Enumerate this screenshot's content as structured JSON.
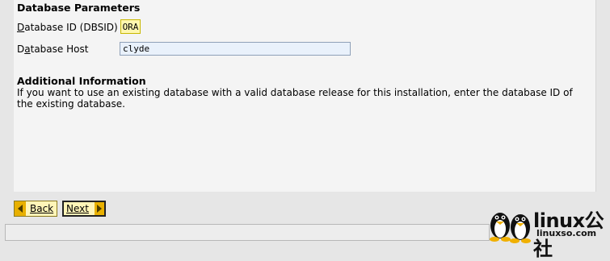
{
  "sections": {
    "db_params_heading": "Database Parameters",
    "additional_info_heading": "Additional Information"
  },
  "fields": {
    "dbsid": {
      "label_u": "D",
      "label_rest": "atabase ID (DBSID)",
      "value": "ORA"
    },
    "host": {
      "label_pre": "D",
      "label_u": "a",
      "label_rest": "tabase Host",
      "value": "clyde"
    }
  },
  "info_text": "If you want to use an existing database with a valid database release for this installation, enter the database ID of the existing database.",
  "buttons": {
    "back_u": "B",
    "back_rest": "ack",
    "next_u": "N",
    "next_rest": "ext"
  },
  "watermark": {
    "logo_text": "linux公社",
    "url": "linuxso.com"
  },
  "colors": {
    "panel": "#f4f4f4",
    "button_bg": "#fff5b8",
    "button_arrow": "#e8b000",
    "input_bg": "#e9f1fb",
    "sid_bg": "#fff7b0"
  }
}
